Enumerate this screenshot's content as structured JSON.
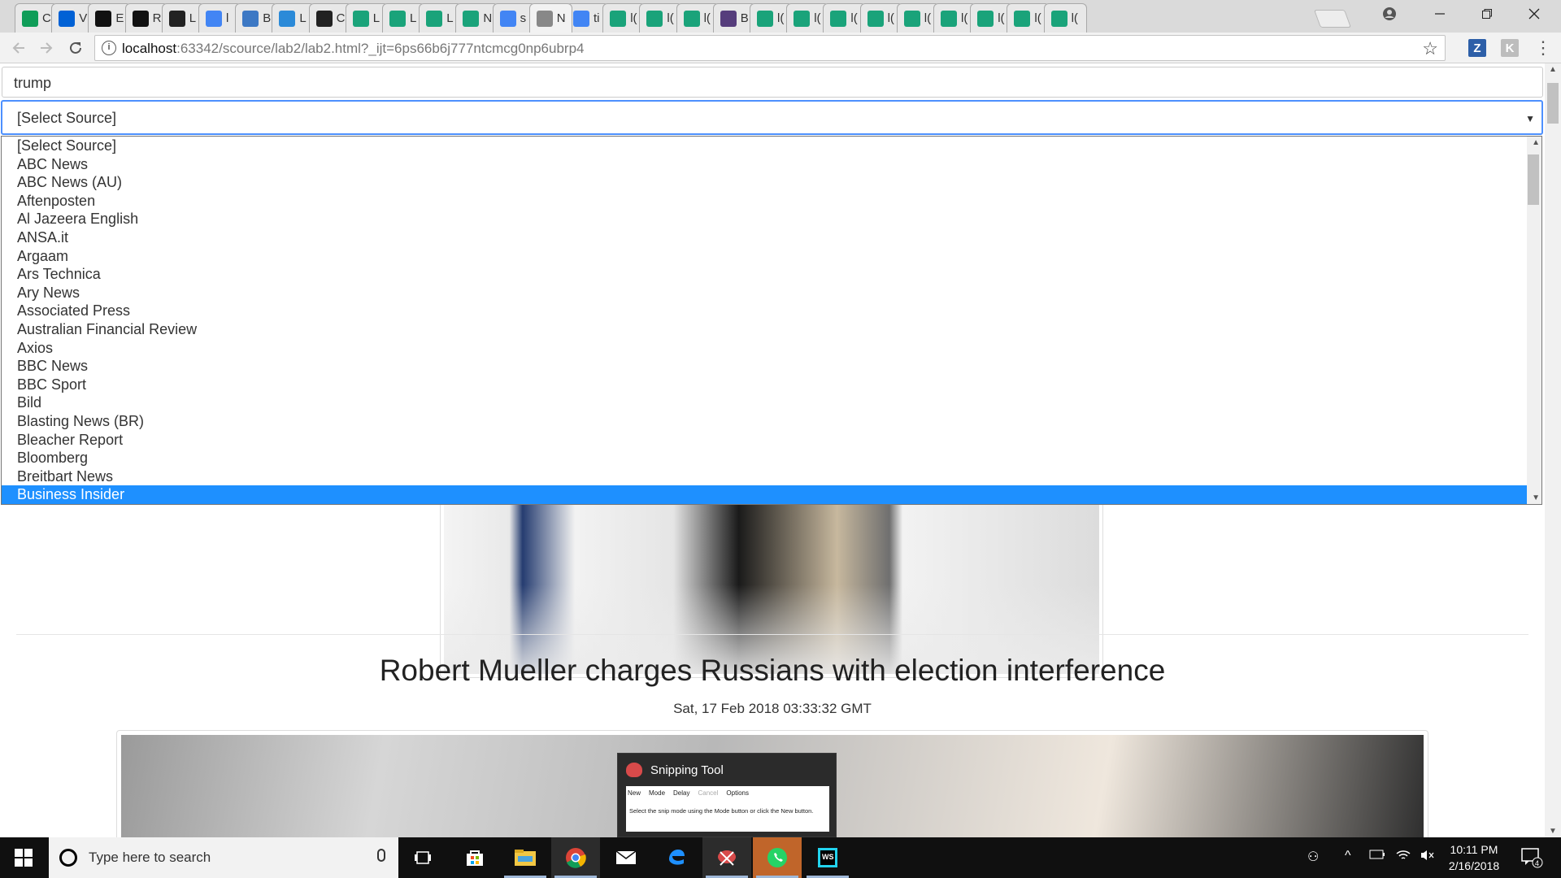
{
  "browser": {
    "tabs": [
      {
        "label": "C",
        "icon": "sheets-icon",
        "color": "#0f9d58"
      },
      {
        "label": "V",
        "icon": "box-icon",
        "color": "#0061d5"
      },
      {
        "label": "E",
        "icon": "notion-icon",
        "color": "#111111"
      },
      {
        "label": "R",
        "icon": "notion-icon",
        "color": "#111111"
      },
      {
        "label": "L",
        "icon": "github-icon",
        "color": "#222222"
      },
      {
        "label": "l",
        "icon": "google-icon",
        "color": "#4285f4"
      },
      {
        "label": "B",
        "icon": "code-icon",
        "color": "#3c78c4"
      },
      {
        "label": "L",
        "icon": "drop-icon",
        "color": "#2b8ad8"
      },
      {
        "label": "C",
        "icon": "github-icon",
        "color": "#222222"
      },
      {
        "label": "L",
        "icon": "webstorm-icon",
        "color": "#1aa37a"
      },
      {
        "label": "L",
        "icon": "webstorm-icon",
        "color": "#1aa37a"
      },
      {
        "label": "L",
        "icon": "webstorm-icon",
        "color": "#1aa37a"
      },
      {
        "label": "N",
        "icon": "webstorm-icon",
        "color": "#1aa37a"
      },
      {
        "label": "s",
        "icon": "google-icon",
        "color": "#4285f4"
      },
      {
        "label": "N",
        "icon": "generic-icon",
        "color": "#888888",
        "active": true
      },
      {
        "label": "ti",
        "icon": "google-icon",
        "color": "#4285f4"
      },
      {
        "label": "l(",
        "icon": "webstorm-icon",
        "color": "#1aa37a"
      },
      {
        "label": "l(",
        "icon": "webstorm-icon",
        "color": "#1aa37a"
      },
      {
        "label": "l(",
        "icon": "webstorm-icon",
        "color": "#1aa37a"
      },
      {
        "label": "B",
        "icon": "bootstrap-icon",
        "color": "#563d7c"
      },
      {
        "label": "l(",
        "icon": "webstorm-icon",
        "color": "#1aa37a"
      },
      {
        "label": "l(",
        "icon": "webstorm-icon",
        "color": "#1aa37a"
      },
      {
        "label": "l(",
        "icon": "webstorm-icon",
        "color": "#1aa37a"
      },
      {
        "label": "l(",
        "icon": "webstorm-icon",
        "color": "#1aa37a"
      },
      {
        "label": "l(",
        "icon": "webstorm-icon",
        "color": "#1aa37a"
      },
      {
        "label": "l(",
        "icon": "webstorm-icon",
        "color": "#1aa37a"
      },
      {
        "label": "l(",
        "icon": "webstorm-icon",
        "color": "#1aa37a"
      },
      {
        "label": "l(",
        "icon": "webstorm-icon",
        "color": "#1aa37a"
      },
      {
        "label": "l(",
        "icon": "webstorm-icon",
        "color": "#1aa37a"
      }
    ],
    "url_host": "localhost",
    "url_rest": ":63342/scource/lab2/lab2.html?_ijt=6ps66b6j777ntcmcg0np6ubrp4",
    "ext_z": "Z",
    "ext_k": "K"
  },
  "page": {
    "search_value": "trump",
    "select_value": "[Select Source]",
    "sources": [
      "[Select Source]",
      "ABC News",
      "ABC News (AU)",
      "Aftenposten",
      "Al Jazeera English",
      "ANSA.it",
      "Argaam",
      "Ars Technica",
      "Ary News",
      "Associated Press",
      "Australian Financial Review",
      "Axios",
      "BBC News",
      "BBC Sport",
      "Bild",
      "Blasting News (BR)",
      "Bleacher Report",
      "Bloomberg",
      "Breitbart News",
      "Business Insider"
    ],
    "highlighted_index": 19,
    "headline": "Robert Mueller charges Russians with election interference",
    "date": "Sat, 17 Feb 2018 03:33:32 GMT"
  },
  "snipping_tool": {
    "title": "Snipping Tool",
    "toolbar": [
      "New",
      "Mode",
      "Delay",
      "Cancel",
      "Options"
    ],
    "help": "Select the snip mode using the Mode button or click the New button."
  },
  "taskbar": {
    "search_placeholder": "Type here to search",
    "time": "10:11 PM",
    "date": "2/16/2018",
    "notifications": "4"
  }
}
